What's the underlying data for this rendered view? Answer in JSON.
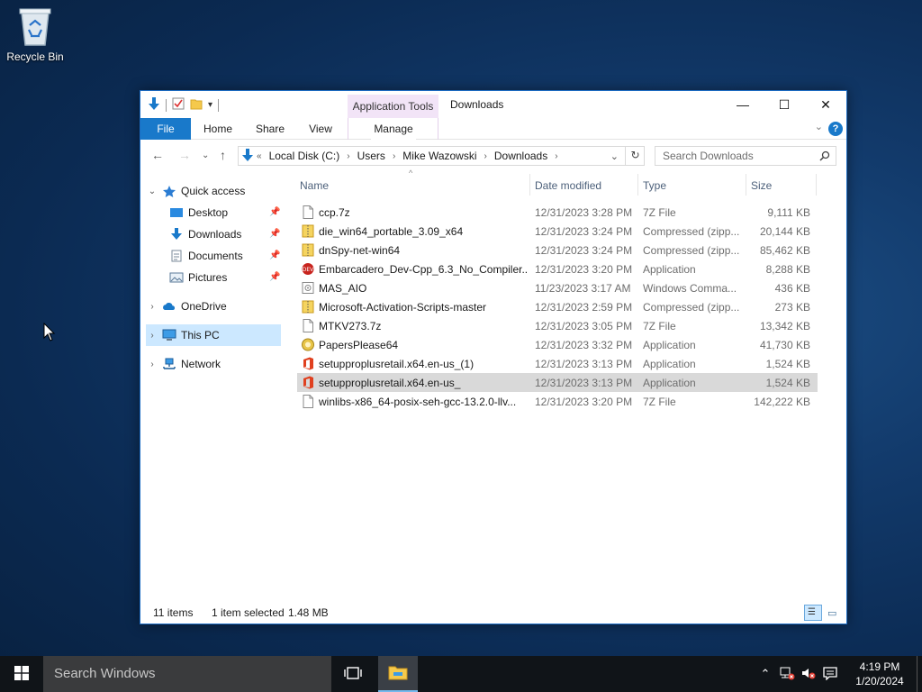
{
  "desktop": {
    "recycle_bin_label": "Recycle Bin"
  },
  "window": {
    "title": "Downloads",
    "contextual_tab_group": "Application Tools",
    "ribbon_tabs": [
      "File",
      "Home",
      "Share",
      "View",
      "Manage"
    ],
    "address": {
      "overflow": "«",
      "crumbs": [
        "Local Disk (C:)",
        "Users",
        "Mike Wazowski",
        "Downloads"
      ]
    },
    "search_placeholder": "Search Downloads",
    "nav": {
      "quick_access": "Quick access",
      "desktop": "Desktop",
      "downloads": "Downloads",
      "documents": "Documents",
      "pictures": "Pictures",
      "onedrive": "OneDrive",
      "this_pc": "This PC",
      "network": "Network"
    },
    "columns": {
      "name": "Name",
      "date": "Date modified",
      "type": "Type",
      "size": "Size"
    },
    "files": [
      {
        "name": "ccp.7z",
        "date": "12/31/2023 3:28 PM",
        "type": "7Z File",
        "size": "9,111 KB",
        "icon": "file-icon"
      },
      {
        "name": "die_win64_portable_3.09_x64",
        "date": "12/31/2023 3:24 PM",
        "type": "Compressed (zipp...",
        "size": "20,144 KB",
        "icon": "zip-folder-icon"
      },
      {
        "name": "dnSpy-net-win64",
        "date": "12/31/2023 3:24 PM",
        "type": "Compressed (zipp...",
        "size": "85,462 KB",
        "icon": "zip-folder-icon"
      },
      {
        "name": "Embarcadero_Dev-Cpp_6.3_No_Compiler...",
        "date": "12/31/2023 3:20 PM",
        "type": "Application",
        "size": "8,288 KB",
        "icon": "devcpp-icon"
      },
      {
        "name": "MAS_AIO",
        "date": "11/23/2023 3:17 AM",
        "type": "Windows Comma...",
        "size": "436 KB",
        "icon": "cmd-file-icon"
      },
      {
        "name": "Microsoft-Activation-Scripts-master",
        "date": "12/31/2023 2:59 PM",
        "type": "Compressed (zipp...",
        "size": "273 KB",
        "icon": "zip-folder-icon"
      },
      {
        "name": "MTKV273.7z",
        "date": "12/31/2023 3:05 PM",
        "type": "7Z File",
        "size": "13,342 KB",
        "icon": "file-icon"
      },
      {
        "name": "PapersPlease64",
        "date": "12/31/2023 3:32 PM",
        "type": "Application",
        "size": "41,730 KB",
        "icon": "papers-please-icon"
      },
      {
        "name": "setupproplusretail.x64.en-us_(1)",
        "date": "12/31/2023 3:13 PM",
        "type": "Application",
        "size": "1,524 KB",
        "icon": "office-icon"
      },
      {
        "name": "setupproplusretail.x64.en-us_",
        "date": "12/31/2023 3:13 PM",
        "type": "Application",
        "size": "1,524 KB",
        "icon": "office-icon",
        "selected": true
      },
      {
        "name": "winlibs-x86_64-posix-seh-gcc-13.2.0-llv...",
        "date": "12/31/2023 3:20 PM",
        "type": "7Z File",
        "size": "142,222 KB",
        "icon": "file-icon"
      }
    ],
    "status": {
      "count": "11 items",
      "selection": "1 item selected",
      "size": "1.48 MB"
    }
  },
  "taskbar": {
    "search_placeholder": "Search Windows",
    "time": "4:19 PM",
    "date": "1/20/2024"
  },
  "colors": {
    "accent": "#1979ca",
    "selected_row": "#d9d9d9",
    "contextual_tab": "#f2e4f7",
    "nav_selected": "#cce8ff"
  }
}
